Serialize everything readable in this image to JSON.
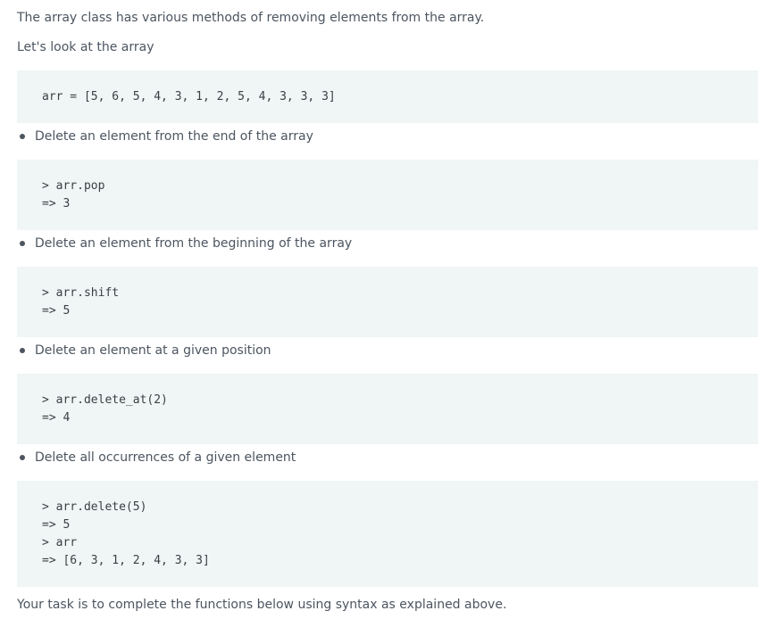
{
  "intro": {
    "line1": "The array class has various methods of removing elements from the array.",
    "line2": "Let's look at the array"
  },
  "array_def": {
    "code": "arr = [5, 6, 5, 4, 3, 1, 2, 5, 4, 3, 3, 3]"
  },
  "sections": [
    {
      "bullet": "Delete an element from the end of the array",
      "code": [
        "> arr.pop",
        "=> 3"
      ]
    },
    {
      "bullet": "Delete an element from the beginning of the array",
      "code": [
        "> arr.shift",
        "=> 5"
      ]
    },
    {
      "bullet": "Delete an element at a given position",
      "code": [
        "> arr.delete_at(2)",
        "=> 4"
      ]
    },
    {
      "bullet": "Delete all occurrences of a given element",
      "code": [
        "> arr.delete(5)",
        "=> 5",
        "> arr",
        "=> [6, 3, 1, 2, 4, 3, 3]"
      ]
    }
  ],
  "outro": {
    "text": "Your task is to complete the functions below using syntax as explained above."
  }
}
